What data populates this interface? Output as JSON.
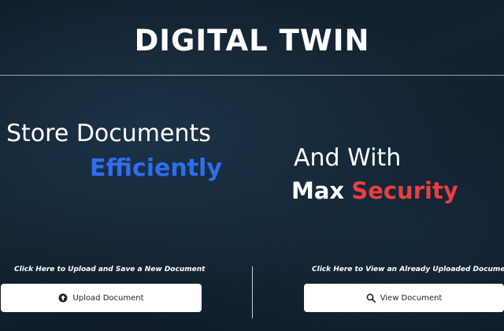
{
  "header": {
    "title": "DIGITAL TWIN"
  },
  "hero": {
    "left_line1": "Store Documents",
    "left_line2": "Efficiently",
    "right_line1": "And With",
    "right_line2_a": "Max",
    "right_line2_b": "Security"
  },
  "actions": {
    "upload": {
      "caption": "Click Here to Upload and Save a New Document",
      "button_label": "Upload Document",
      "icon": "upload-circle-icon"
    },
    "view": {
      "caption": "Click Here to View an Already Uploaded Document",
      "button_label": "View Document",
      "icon": "search-icon"
    }
  },
  "colors": {
    "accent_blue": "#2f6df0",
    "accent_red": "#e8403e",
    "background": "#132331"
  }
}
